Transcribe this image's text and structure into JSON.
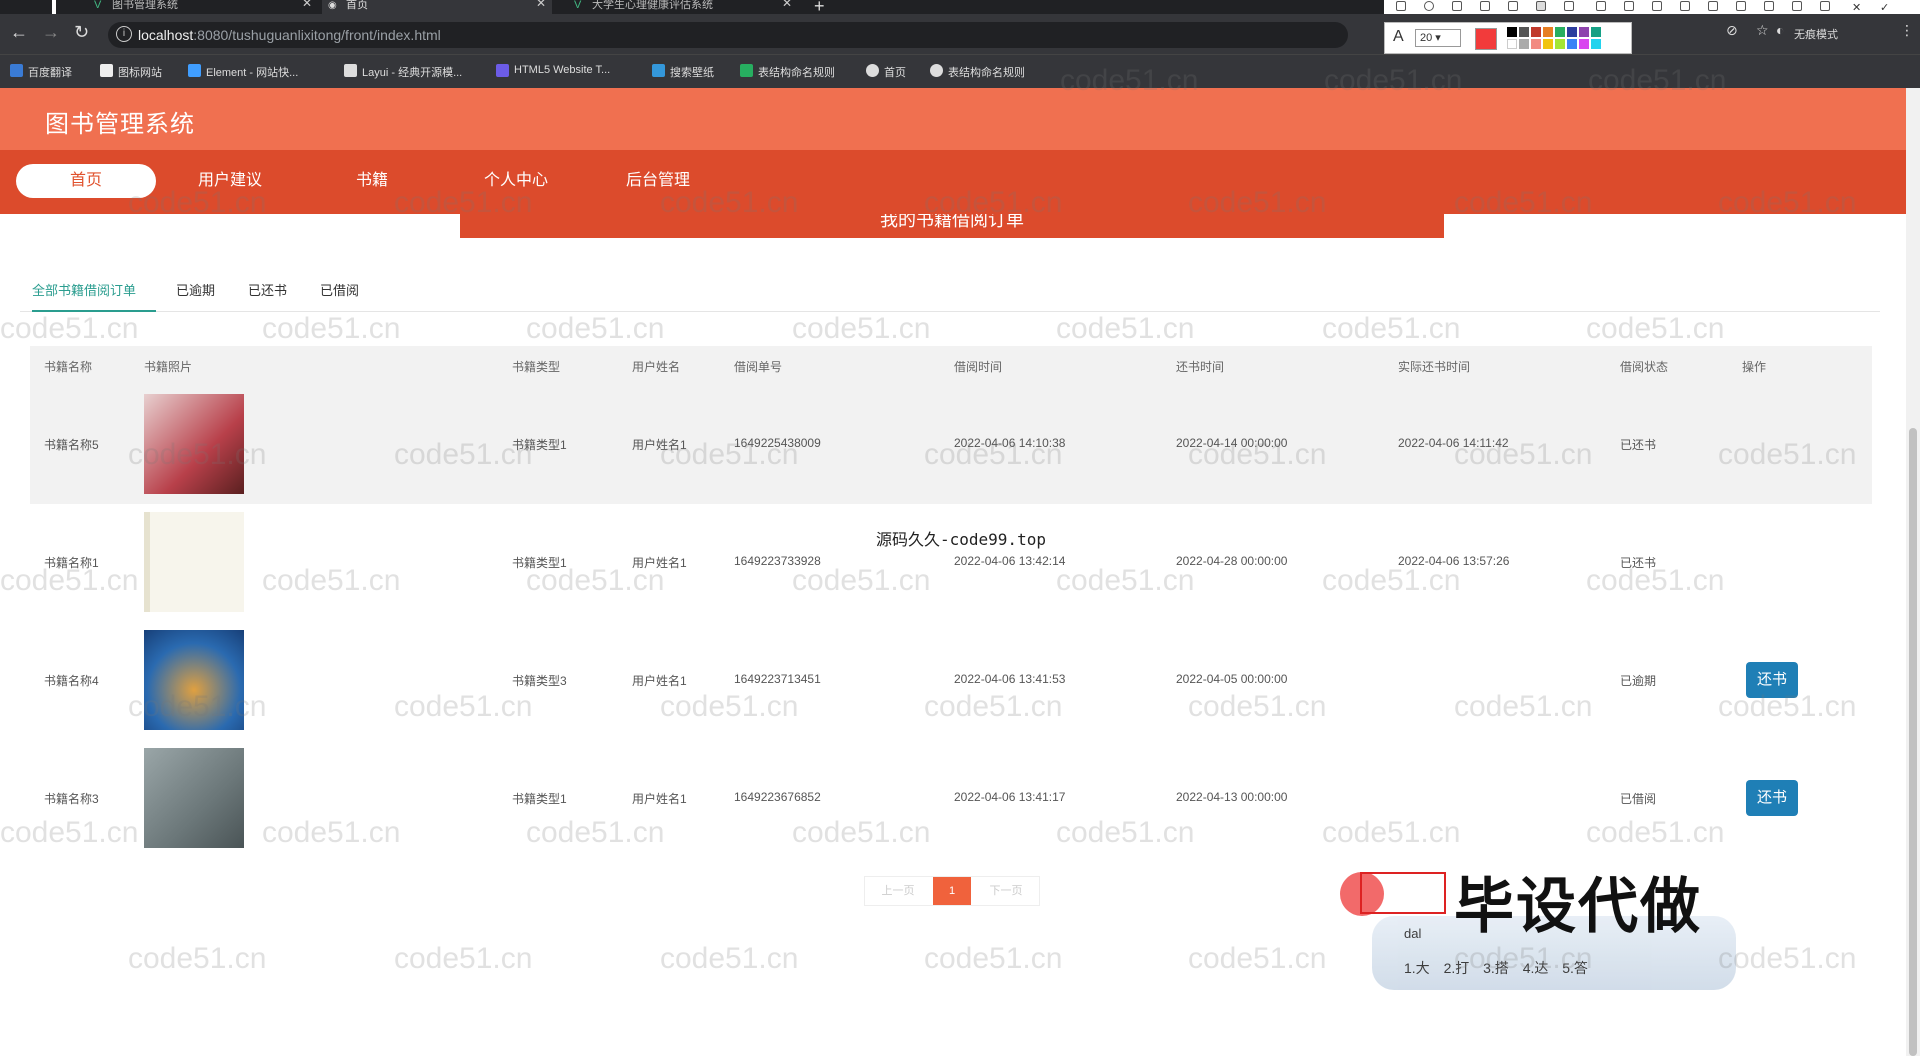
{
  "browser": {
    "tabs": [
      {
        "label": "图书管理系统",
        "active": false
      },
      {
        "label": "首页",
        "active": true
      },
      {
        "label": "大学生心理健康评估系统",
        "active": false
      }
    ],
    "url_host": "localhost",
    "url_path": ":8080/tushuguanlixitong/front/index.html",
    "incognito_label": "无痕模式",
    "bookmarks": [
      {
        "label": "百度翻译",
        "color": "#3a7bd5"
      },
      {
        "label": "图标网站",
        "color": "#eee"
      },
      {
        "label": "Element - 网站快...",
        "color": "#409eff"
      },
      {
        "label": "Layui - 经典开源模...",
        "color": "#ddd"
      },
      {
        "label": "HTML5 Website T...",
        "color": "#6c5ce7"
      },
      {
        "label": "搜索壁纸",
        "color": "#3498db"
      },
      {
        "label": "表结构命名规则",
        "color": "#27ae60"
      },
      {
        "label": "首页",
        "color": "#ddd"
      },
      {
        "label": "表结构命名规则",
        "color": "#ddd"
      }
    ]
  },
  "snaptool": {
    "font_size": "20",
    "current_color": "#f23b3b"
  },
  "app": {
    "title": "图书管理系统",
    "nav": [
      {
        "label": "首页",
        "active": true
      },
      {
        "label": "用户建议",
        "active": false
      },
      {
        "label": "书籍",
        "active": false
      },
      {
        "label": "个人中心",
        "active": false
      },
      {
        "label": "后台管理",
        "active": false
      }
    ],
    "banner_text": "我的书籍借阅订单",
    "subtabs": [
      {
        "label": "全部书籍借阅订单",
        "active": true
      },
      {
        "label": "已逾期",
        "active": false
      },
      {
        "label": "已还书",
        "active": false
      },
      {
        "label": "已借阅",
        "active": false
      }
    ]
  },
  "table": {
    "headers": [
      "书籍名称",
      "书籍照片",
      "书籍类型",
      "用户姓名",
      "借阅单号",
      "借阅时间",
      "还书时间",
      "实际还书时间",
      "借阅状态",
      "操作"
    ],
    "rows": [
      {
        "name": "书籍名称5",
        "type": "书籍类型1",
        "user": "用户姓名1",
        "order_no": "1649225438009",
        "borrow_time": "2022-04-06 14:10:38",
        "return_time": "2022-04-14 00:00:00",
        "actual_return": "2022-04-06 14:11:42",
        "status": "已还书",
        "action": "",
        "thumb_color": "#b8404a",
        "highlight": true
      },
      {
        "name": "书籍名称1",
        "type": "书籍类型1",
        "user": "用户姓名1",
        "order_no": "1649223733928",
        "borrow_time": "2022-04-06 13:42:14",
        "return_time": "2022-04-28 00:00:00",
        "actual_return": "2022-04-06 13:57:26",
        "status": "已还书",
        "action": "",
        "thumb_color": "#f4f1e6",
        "highlight": false
      },
      {
        "name": "书籍名称4",
        "type": "书籍类型3",
        "user": "用户姓名1",
        "order_no": "1649223713451",
        "borrow_time": "2022-04-06 13:41:53",
        "return_time": "2022-04-05 00:00:00",
        "actual_return": "",
        "status": "已逾期",
        "action": "还书",
        "thumb_color": "#1f5ea8",
        "highlight": false
      },
      {
        "name": "书籍名称3",
        "type": "书籍类型1",
        "user": "用户姓名1",
        "order_no": "1649223676852",
        "borrow_time": "2022-04-06 13:41:17",
        "return_time": "2022-04-13 00:00:00",
        "actual_return": "",
        "status": "已借阅",
        "action": "还书",
        "thumb_color": "#7d8a8c",
        "highlight": false
      }
    ]
  },
  "pager": {
    "prev": "上一页",
    "current": "1",
    "next": "下一页"
  },
  "overlay": {
    "center_text": "源码久久-code99.top",
    "promo": "毕设代做",
    "ime_input": "dal",
    "ime_candidates": "1.大 2.打 3.搭 4.达 5.答",
    "watermark": "code51.cn"
  }
}
